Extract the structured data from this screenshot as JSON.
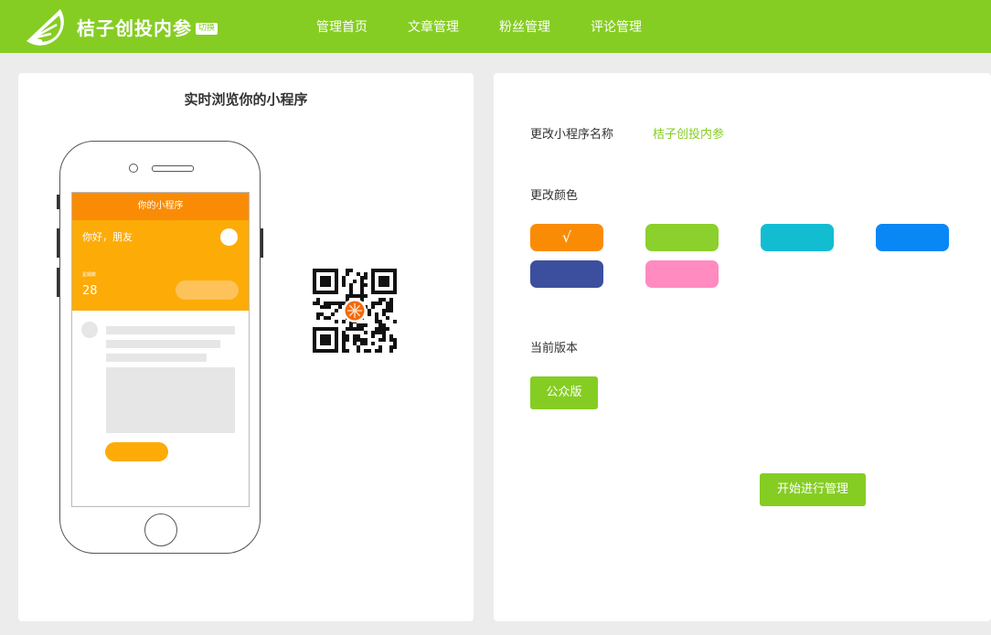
{
  "header": {
    "brand": "桔子创投内参",
    "badge": "切换",
    "nav": [
      "管理首页",
      "文章管理",
      "粉丝管理",
      "评论管理"
    ]
  },
  "preview": {
    "title": "实时浏览你的小程序",
    "mini_title": "你的小程序",
    "greeting": "你好，朋友",
    "stat_label": "星期数",
    "stat_value": "28"
  },
  "settings": {
    "name_label": "更改小程序名称",
    "name_value": "桔子创投内参",
    "color_label": "更改颜色",
    "colors": [
      "#fa8c05",
      "#8bd02c",
      "#12bdd2",
      "#0987f5",
      "#3c4f9e",
      "#ff8bc1"
    ],
    "selected_color_mark": "√",
    "version_label": "当前版本",
    "version_value": "公众版",
    "start_button": "开始进行管理"
  }
}
